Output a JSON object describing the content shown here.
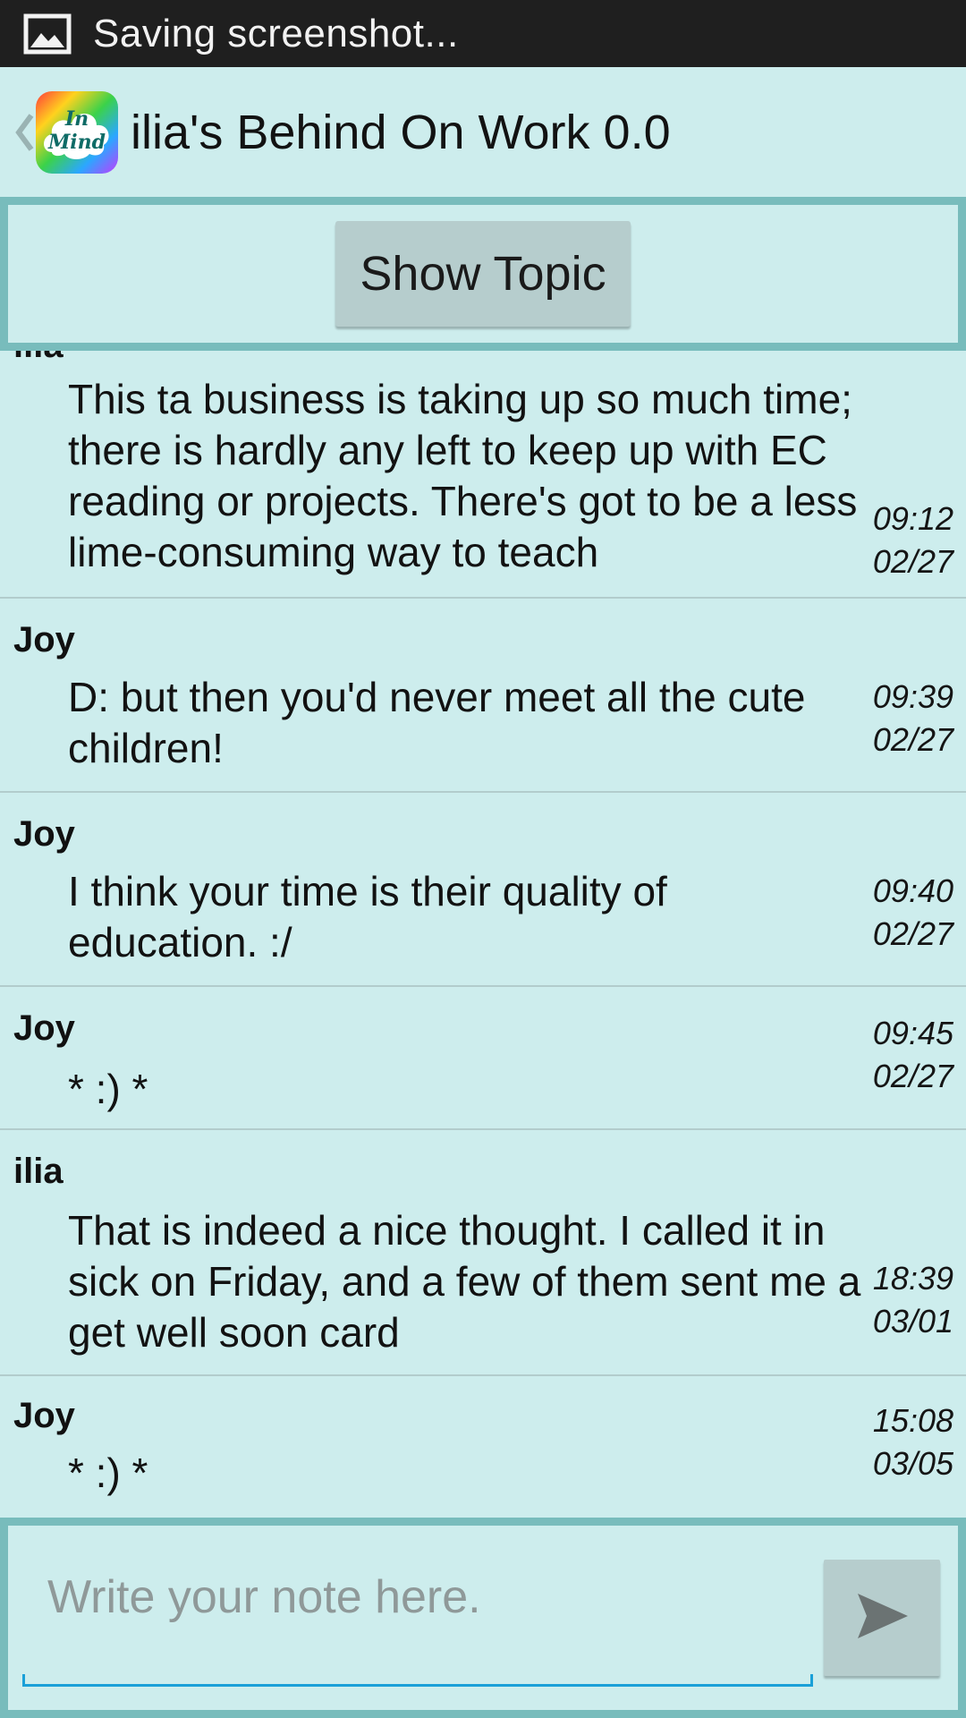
{
  "status_bar": {
    "text": "Saving screenshot...",
    "icon": "image-icon"
  },
  "action_bar": {
    "back_icon": "chevron-left-icon",
    "logo_line1": "In",
    "logo_line2": "Mind",
    "title": "ilia's Behind On Work 0.0"
  },
  "topic": {
    "button_label": "Show Topic"
  },
  "messages": [
    {
      "author": "ilia",
      "text": "This ta business is taking up so much time; there is hardly any left to keep up with EC reading or projects. There's got to be a less lime-consuming way to teach",
      "time": "09:12",
      "date": "02/27"
    },
    {
      "author": "Joy",
      "text": "D: but then you'd never meet all the cute children!",
      "time": "09:39",
      "date": "02/27"
    },
    {
      "author": "Joy",
      "text": "I think your time is their quality of education. :/",
      "time": "09:40",
      "date": "02/27"
    },
    {
      "author": "Joy",
      "text": "* :) *",
      "time": "09:45",
      "date": "02/27"
    },
    {
      "author": "ilia",
      "text": "That is indeed a nice thought. I called it in sick on Friday, and a few of them sent me a get well soon card",
      "time": "18:39",
      "date": "03/01"
    },
    {
      "author": "Joy",
      "text": "* :) *",
      "time": "15:08",
      "date": "03/05"
    }
  ],
  "composer": {
    "placeholder": "Write your note here.",
    "value": "",
    "send_icon": "send-icon"
  },
  "colors": {
    "background": "#cdeded",
    "panel_border": "#78bcbc",
    "button": "#b6cdcd",
    "status_bar": "#1f1f1f",
    "input_underline": "#1aa0d8"
  }
}
